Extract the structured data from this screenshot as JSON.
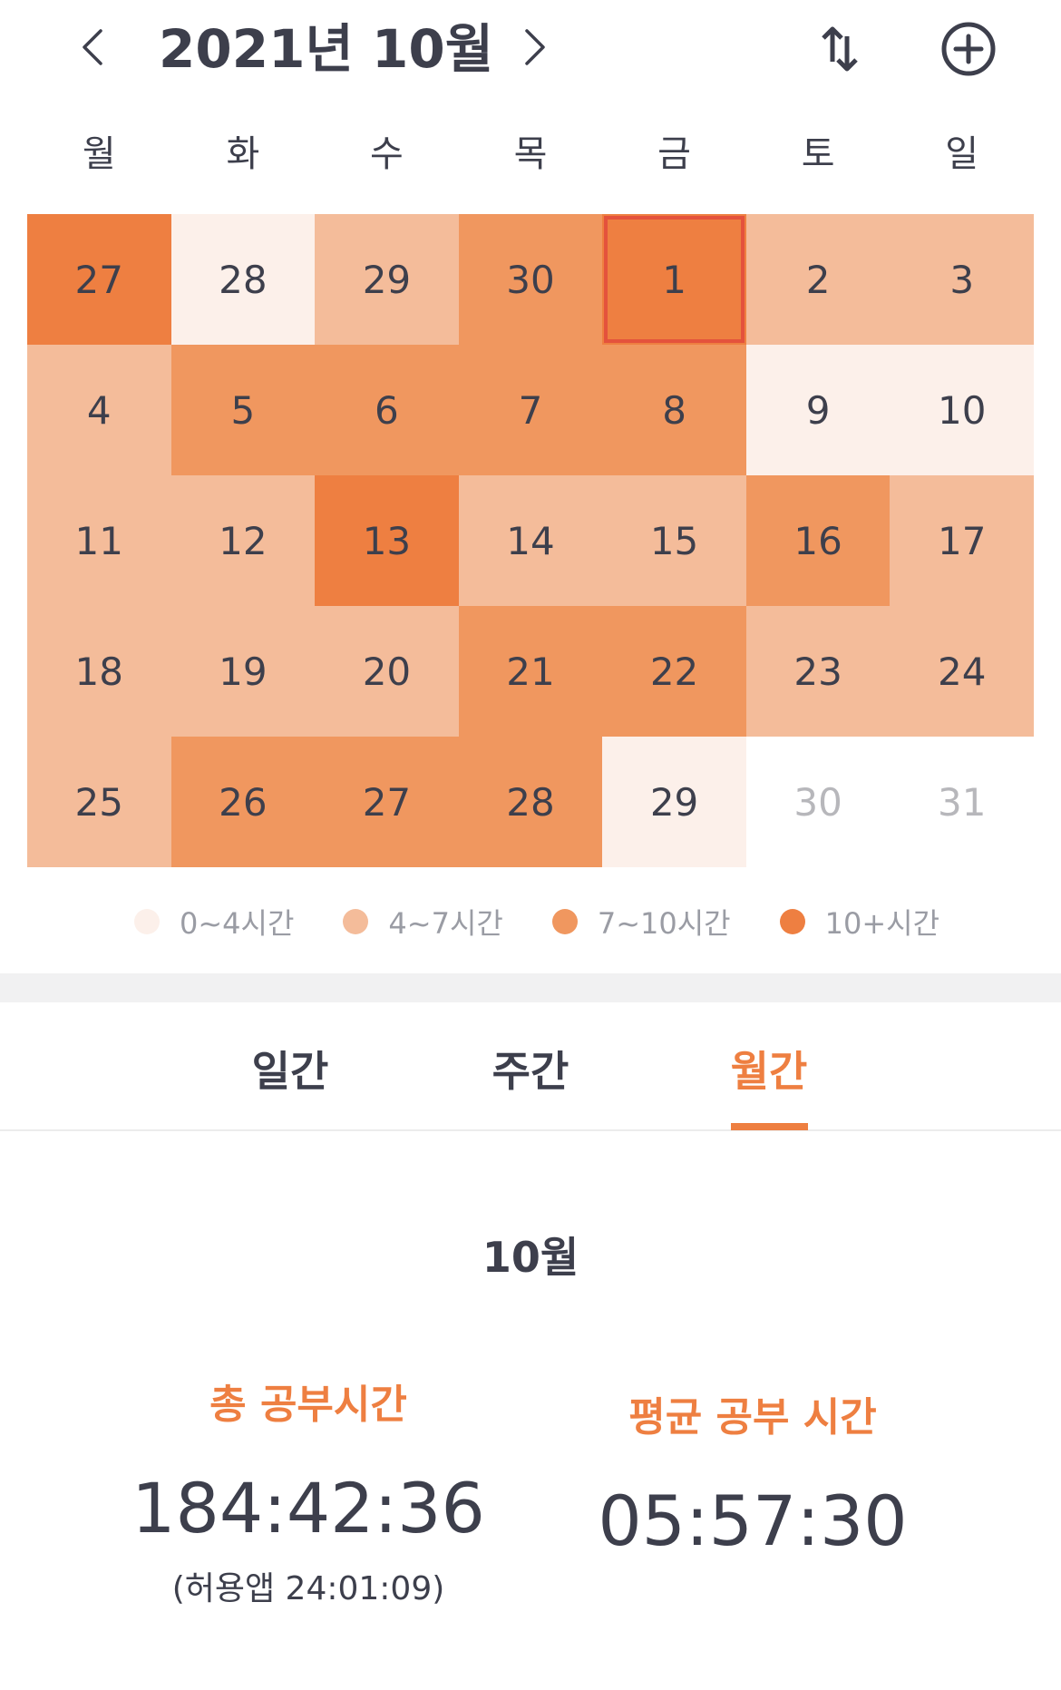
{
  "header": {
    "title": "2021년 10월",
    "prev_icon": "chevron-left-icon",
    "next_icon": "chevron-right-icon",
    "sort_icon": "sort-arrows-icon",
    "add_icon": "plus-circle-icon"
  },
  "weekdays": [
    "월",
    "화",
    "수",
    "목",
    "금",
    "토",
    "일"
  ],
  "calendar": {
    "days": [
      {
        "label": "27",
        "level": 3
      },
      {
        "label": "28",
        "level": 0
      },
      {
        "label": "29",
        "level": 1
      },
      {
        "label": "30",
        "level": 2
      },
      {
        "label": "1",
        "level": 3,
        "today": true
      },
      {
        "label": "2",
        "level": 1
      },
      {
        "label": "3",
        "level": 1
      },
      {
        "label": "4",
        "level": 1
      },
      {
        "label": "5",
        "level": 2
      },
      {
        "label": "6",
        "level": 2
      },
      {
        "label": "7",
        "level": 2
      },
      {
        "label": "8",
        "level": 2
      },
      {
        "label": "9",
        "level": 0
      },
      {
        "label": "10",
        "level": 0
      },
      {
        "label": "11",
        "level": 1
      },
      {
        "label": "12",
        "level": 1
      },
      {
        "label": "13",
        "level": 3
      },
      {
        "label": "14",
        "level": 1
      },
      {
        "label": "15",
        "level": 1
      },
      {
        "label": "16",
        "level": 2
      },
      {
        "label": "17",
        "level": 1
      },
      {
        "label": "18",
        "level": 1
      },
      {
        "label": "19",
        "level": 1
      },
      {
        "label": "20",
        "level": 1
      },
      {
        "label": "21",
        "level": 2
      },
      {
        "label": "22",
        "level": 2
      },
      {
        "label": "23",
        "level": 1
      },
      {
        "label": "24",
        "level": 1
      },
      {
        "label": "25",
        "level": 1
      },
      {
        "label": "26",
        "level": 2
      },
      {
        "label": "27",
        "level": 2
      },
      {
        "label": "28",
        "level": 2
      },
      {
        "label": "29",
        "level": 0
      },
      {
        "label": "30",
        "level": -1
      },
      {
        "label": "31",
        "level": -1
      }
    ]
  },
  "legend": [
    {
      "label": "0~4시간",
      "color": "#fcf0ea"
    },
    {
      "label": "4~7시간",
      "color": "#f4bc9a"
    },
    {
      "label": "7~10시간",
      "color": "#f0975f"
    },
    {
      "label": "10+시간",
      "color": "#ee7f41"
    }
  ],
  "tabs": {
    "daily": "일간",
    "weekly": "주간",
    "monthly": "월간",
    "active": "monthly"
  },
  "stats": {
    "period": "10월",
    "total_label": "총 공부시간",
    "total_value": "184:42:36",
    "allowed_app": "(허용앱  24:01:09)",
    "avg_label": "평균 공부 시간",
    "avg_value": "05:57:30"
  },
  "colors": {
    "accent": "#ee7f41",
    "today_border": "#e4523c",
    "text": "#3d3f4c"
  }
}
